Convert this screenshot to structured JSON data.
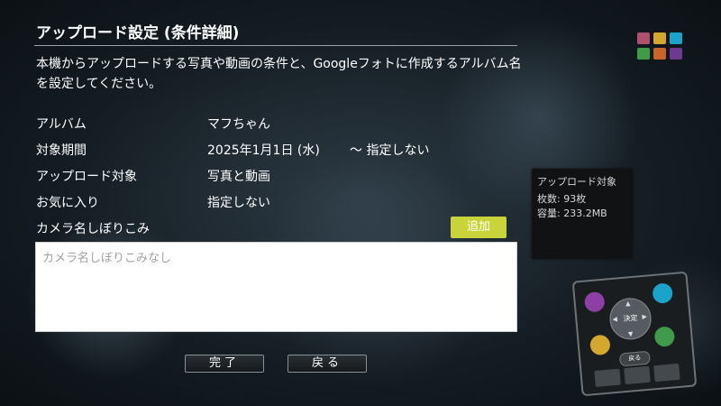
{
  "page": {
    "title": "アップロード設定 (条件詳細)",
    "description": "本機からアップロードする写真や動画の条件と、Googleフォトに作成するアルバム名を設定してください。"
  },
  "settings": {
    "album_label": "アルバム",
    "album_value": "マフちゃん",
    "period_label": "対象期間",
    "period_start": "2025年1月1日 (水)",
    "period_end": "～ 指定しない",
    "target_label": "アップロード対象",
    "target_value": "写真と動画",
    "favorite_label": "お気に入り",
    "favorite_value": "指定しない",
    "camera_label": "カメラ名しぼりこみ",
    "add_label": "追加",
    "camera_placeholder": "カメラ名しぼりこみなし"
  },
  "buttons": {
    "done_label": "完了",
    "back_label": "戻る"
  },
  "info_panel": {
    "title": "アップロード対象",
    "count": "枚数: 93枚",
    "size": "容量: 233.2MB"
  },
  "remote": {
    "center_label": "決定",
    "back_label": "戻る",
    "button_colors": [
      "#8e3fa6",
      "#1ba3c9",
      "#d4a72e",
      "#3f9a4a"
    ]
  },
  "grid_icon": {
    "colors": [
      "#b0506e",
      "#d4a72e",
      "#1ba3c9",
      "#3f9a4a",
      "#c8632a",
      "#6d3a8f"
    ]
  }
}
